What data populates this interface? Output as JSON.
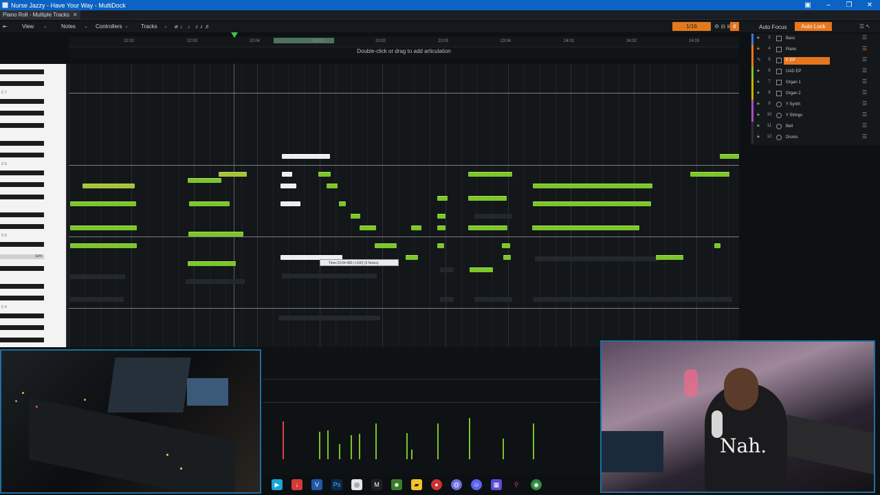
{
  "window": {
    "title": "Nurse Jazzy - Have Your Way - MultiDock"
  },
  "dock": {
    "tab_label": "Piano Roll - Multiple Tracks"
  },
  "menu": {
    "view": "View",
    "notes": "Notes",
    "controllers": "Controllers",
    "tracks": "Tracks",
    "snap": "1/16",
    "auto_focus": "Auto Focus",
    "auto_lock": "Auto Lock"
  },
  "ruler": {
    "ticks": [
      "22:02",
      "22:03",
      "22:04",
      "23:01",
      "23:02",
      "23:03",
      "23:04",
      "24:01",
      "24:02",
      "24:03"
    ]
  },
  "hint": "Double-click or drag to add articulation",
  "piano": {
    "labels": [
      "C 7",
      "C 6",
      "C 5",
      "C 4"
    ],
    "hover_key": "G#4"
  },
  "tooltip": "Time:23:04:480 (+100) (5 Notes)",
  "tracks": [
    {
      "num": "3",
      "name": "Bass",
      "color": "#3a7bd5"
    },
    {
      "num": "4",
      "name": "Piano",
      "color": "#e8761e"
    },
    {
      "num": "5",
      "name": "E EP",
      "color": "#e8761e",
      "active": true
    },
    {
      "num": "6",
      "name": "UAD EP",
      "color": "#7cc52a"
    },
    {
      "num": "7",
      "name": "Organ 1",
      "color": "#c8b400"
    },
    {
      "num": "8",
      "name": "Organ 2",
      "color": "#c8b400"
    },
    {
      "num": "9",
      "name": "Y Synth",
      "color": "#b04ad0"
    },
    {
      "num": "10",
      "name": "Y Strings",
      "color": "#b04ad0"
    },
    {
      "num": "11",
      "name": "Bell",
      "color": "#2a2e33"
    },
    {
      "num": "12",
      "name": "Drums",
      "color": "#2a2e33"
    }
  ],
  "colors": {
    "accent": "#e8761e",
    "note": "#7cc52a",
    "titlebar": "#0b63c4"
  },
  "cam": {
    "shirt_text": "Nah."
  }
}
